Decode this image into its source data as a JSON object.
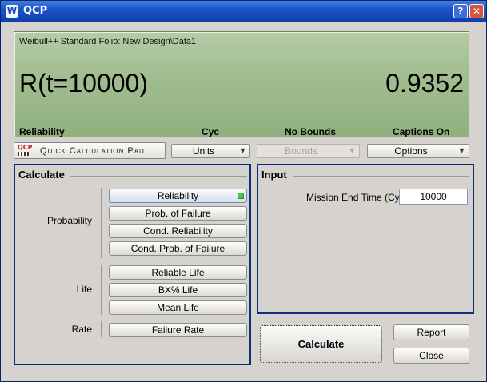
{
  "window": {
    "title": "QCP",
    "icon_glyph": "W",
    "help_glyph": "?",
    "close_glyph": "✕"
  },
  "display": {
    "folio": "Weibull++ Standard Folio: New Design\\Data1",
    "result_label": "R(t=10000)",
    "result_value": "0.9352",
    "status": {
      "metric": "Reliability",
      "units": "Cyc",
      "bounds": "No Bounds",
      "captions": "Captions On"
    },
    "background_color": "#a4bf93"
  },
  "toolbar": {
    "logo_mark": "QCP",
    "logo_text": "Quick Calculation Pad",
    "units_label": "Units",
    "bounds_label": "Bounds",
    "options_label": "Options",
    "dropdown_glyph": "▼"
  },
  "calculate": {
    "title": "Calculate",
    "probability_label": "Probability",
    "life_label": "Life",
    "rate_label": "Rate",
    "buttons": {
      "reliability": "Reliability",
      "prob_failure": "Prob. of Failure",
      "cond_reliability": "Cond. Reliability",
      "cond_prob_failure": "Cond. Prob. of Failure",
      "reliable_life": "Reliable Life",
      "bx_life": "BX% Life",
      "mean_life": "Mean Life",
      "failure_rate": "Failure Rate"
    }
  },
  "input": {
    "title": "Input",
    "mission_label": "Mission End Time (Cyc)",
    "mission_value": "10000"
  },
  "actions": {
    "calculate": "Calculate",
    "report": "Report",
    "close": "Close"
  },
  "colors": {
    "accent": "#0b2f7a",
    "titlebar": "#1b55c9",
    "selected_indicator": "#4cc44c"
  }
}
